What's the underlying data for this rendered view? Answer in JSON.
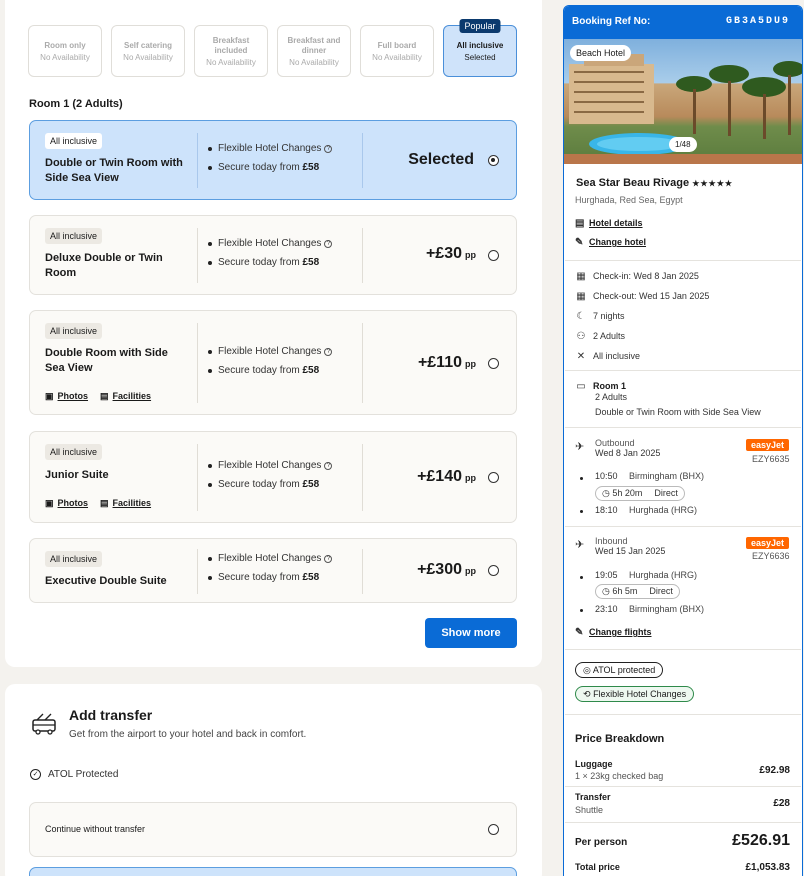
{
  "board_types": [
    {
      "title": "Room only",
      "status": "No Availability",
      "selected": false
    },
    {
      "title": "Self catering",
      "status": "No Availability",
      "selected": false
    },
    {
      "title": "Breakfast included",
      "status": "No Availability",
      "selected": false
    },
    {
      "title": "Breakfast and dinner",
      "status": "No Availability",
      "selected": false
    },
    {
      "title": "Full board",
      "status": "No Availability",
      "selected": false
    },
    {
      "title": "All inclusive",
      "status": "Selected",
      "selected": true,
      "badge": "Popular"
    }
  ],
  "room_heading": "Room 1 (2 Adults)",
  "rooms": [
    {
      "board": "All inclusive",
      "name": "Double or Twin Room with Side Sea View",
      "feature1": "Flexible Hotel Changes",
      "feature2_prefix": "Secure today from ",
      "feature2_amount": "£58",
      "price": "Selected",
      "selected": true
    },
    {
      "board": "All inclusive",
      "name": "Deluxe Double or Twin Room",
      "feature1": "Flexible Hotel Changes",
      "feature2_prefix": "Secure today from ",
      "feature2_amount": "£58",
      "price": "+£30",
      "pp": "pp"
    },
    {
      "board": "All inclusive",
      "name": "Double Room with Side Sea View",
      "feature1": "Flexible Hotel Changes",
      "feature2_prefix": "Secure today from ",
      "feature2_amount": "£58",
      "price": "+£110",
      "pp": "pp",
      "photos": "Photos",
      "facilities": "Facilities"
    },
    {
      "board": "All inclusive",
      "name": "Junior Suite",
      "feature1": "Flexible Hotel Changes",
      "feature2_prefix": "Secure today from ",
      "feature2_amount": "£58",
      "price": "+£140",
      "pp": "pp",
      "photos": "Photos",
      "facilities": "Facilities"
    },
    {
      "board": "All inclusive",
      "name": "Executive Double Suite",
      "feature1": "Flexible Hotel Changes",
      "feature2_prefix": "Secure today from ",
      "feature2_amount": "£58",
      "price": "+£300",
      "pp": "pp"
    }
  ],
  "show_more": "Show more",
  "transfer": {
    "title": "Add transfer",
    "subtitle": "Get from the airport to your hotel and back in comfort.",
    "atol": "ATOL Protected",
    "option1": "Continue without transfer"
  },
  "booking": {
    "ref_label": "Booking Ref No:",
    "ref": "GB3A5DU9",
    "image_tag": "Beach Hotel",
    "image_count": "1/48",
    "hotel_name": "Sea Star Beau Rivage",
    "stars": "★★★★★",
    "location": "Hurghada, Red Sea, Egypt",
    "hotel_details": "Hotel details",
    "change_hotel": "Change hotel",
    "checkin": "Check-in: Wed 8 Jan 2025",
    "checkout": "Check-out: Wed 15 Jan 2025",
    "nights": "7 nights",
    "guests": "2 Adults",
    "board": "All inclusive",
    "room_title": "Room 1",
    "room_guests": "2 Adults",
    "room_name": "Double or Twin Room with Side Sea View",
    "outbound": {
      "label": "Outbound",
      "date": "Wed 8 Jan 2025",
      "airline": "easyJet",
      "flight": "EZY6635",
      "dep_time": "10:50",
      "dep_airport": "Birmingham (BHX)",
      "duration": "5h 20m",
      "type": "Direct",
      "arr_time": "18:10",
      "arr_airport": "Hurghada (HRG)"
    },
    "inbound": {
      "label": "Inbound",
      "date": "Wed 15 Jan 2025",
      "airline": "easyJet",
      "flight": "EZY6636",
      "dep_time": "19:05",
      "dep_airport": "Hurghada (HRG)",
      "duration": "6h 5m",
      "type": "Direct",
      "arr_time": "23:10",
      "arr_airport": "Birmingham (BHX)"
    },
    "change_flights": "Change flights",
    "atol": "ATOL protected",
    "flex": "Flexible Hotel Changes",
    "price_title": "Price Breakdown",
    "luggage_label": "Luggage",
    "luggage_desc": "1 × 23kg checked bag",
    "luggage_price": "£92.98",
    "transfer_label": "Transfer",
    "transfer_desc": "Shuttle",
    "transfer_price": "£28",
    "pp_label": "Per person",
    "pp_price": "£526.91",
    "total_label": "Total price",
    "total_price": "£1,053.83"
  },
  "colors": {
    "accent": "#0a6bd6",
    "selected_bg": "#cde3fb",
    "header_bg": "#0a6bd6",
    "easyjet": "#ff6600"
  }
}
